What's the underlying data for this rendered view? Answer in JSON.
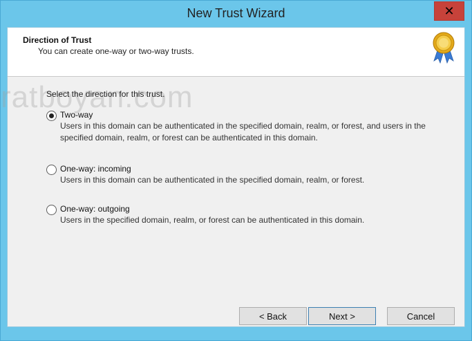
{
  "window": {
    "title": "New Trust Wizard",
    "close_label": "✕"
  },
  "header": {
    "title": "Direction of Trust",
    "subtitle": "You can create one-way or two-way trusts."
  },
  "watermark": "ratboyan.com",
  "body": {
    "prompt": "Select the direction for this trust.",
    "options": [
      {
        "label": "Two-way",
        "description": "Users in this domain can be authenticated in the specified domain, realm, or forest, and users in the specified domain, realm, or forest can be authenticated in this domain.",
        "checked": true
      },
      {
        "label": "One-way: incoming",
        "description": "Users in this domain can be authenticated in the specified domain, realm, or forest.",
        "checked": false
      },
      {
        "label": "One-way: outgoing",
        "description": "Users in the specified domain, realm, or forest can be authenticated in this domain.",
        "checked": false
      }
    ]
  },
  "buttons": {
    "back": "< Back",
    "next": "Next >",
    "cancel": "Cancel"
  },
  "colors": {
    "title_bar": "#6bc6ea",
    "close_button": "#c7423a",
    "dialog_bg": "#f0f0f0"
  }
}
